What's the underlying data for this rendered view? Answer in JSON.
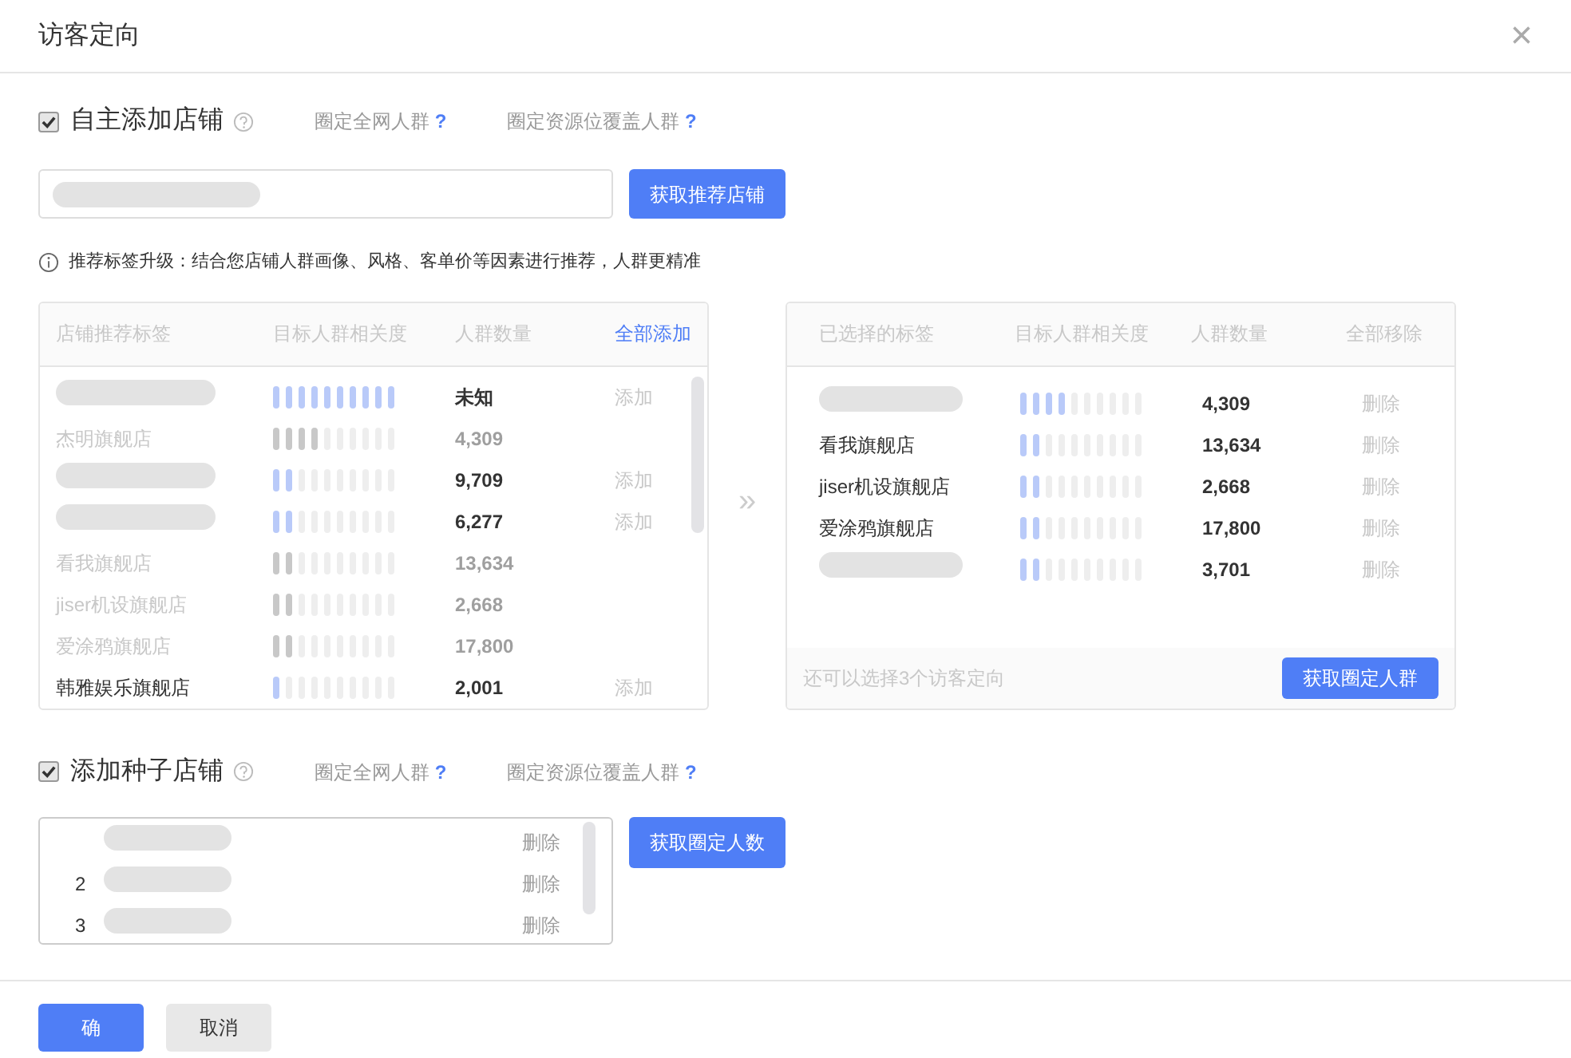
{
  "dialog": {
    "title": "访客定向",
    "close": "×"
  },
  "own_shops": {
    "checked": true,
    "label": "自主添加店铺",
    "links": [
      {
        "text": "圈定全网人群",
        "mark": "?"
      },
      {
        "text": "圈定资源位覆盖人群",
        "mark": "?"
      }
    ],
    "button": "获取推荐店铺",
    "tip": "推荐标签升级：结合您店铺人群画像、风格、客单价等因素进行推荐，人群更精准"
  },
  "recommend_table": {
    "columns": [
      "店铺推荐标签",
      "目标人群相关度",
      "人群数量"
    ],
    "action": "全部添加",
    "rows": [
      {
        "count": "未知",
        "level": 1,
        "added": false,
        "action": "添加"
      },
      {
        "name": "杰明旗舰店",
        "count": "4,309",
        "level": 0.4,
        "added": true
      },
      {
        "count": "9,709",
        "level": 0.2,
        "added": false,
        "action": "添加"
      },
      {
        "count": "6,277",
        "level": 0.2,
        "added": false,
        "action": "添加"
      },
      {
        "name": "看我旗舰店",
        "count": "13,634",
        "level": 0.2,
        "added": true
      },
      {
        "name": "jiser机设旗舰店",
        "count": "2,668",
        "level": 0.2,
        "added": true
      },
      {
        "name": "爱涂鸦旗舰店",
        "count": "17,800",
        "level": 0.2,
        "added": true
      },
      {
        "name": "韩雅娱乐旗舰店",
        "count": "2,001",
        "level": 0.1,
        "added": false,
        "action": "添加"
      }
    ]
  },
  "transfer": "»",
  "selected_table": {
    "columns": [
      "已选择的标签",
      "目标人群相关度",
      "人群数量"
    ],
    "action": "全部移除",
    "rows": [
      {
        "count": "4,309",
        "level": 0.4,
        "action": "删除"
      },
      {
        "name": "看我旗舰店",
        "count": "13,634",
        "level": 0.2,
        "action": "删除"
      },
      {
        "name": "jiser机设旗舰店",
        "count": "2,668",
        "level": 0.2,
        "action": "删除"
      },
      {
        "name": "爱涂鸦旗舰店",
        "count": "17,800",
        "level": 0.2,
        "action": "删除"
      },
      {
        "count": "3,701",
        "level": 0.2,
        "action": "删除"
      }
    ],
    "footer": "还可以选择3个访客定向",
    "button": "获取圈定人群"
  },
  "seed_shops": {
    "checked": true,
    "label": "添加种子店铺",
    "links": [
      {
        "text": "圈定全网人群",
        "mark": "?"
      },
      {
        "text": "圈定资源位覆盖人群",
        "mark": "?"
      }
    ],
    "items": [
      {
        "action": "删除"
      },
      {
        "index": "2",
        "action": "删除"
      },
      {
        "index": "3",
        "action": "删除"
      }
    ],
    "button": "获取圈定人数"
  },
  "footer": {
    "confirm": "确",
    "cancel": "取消"
  }
}
